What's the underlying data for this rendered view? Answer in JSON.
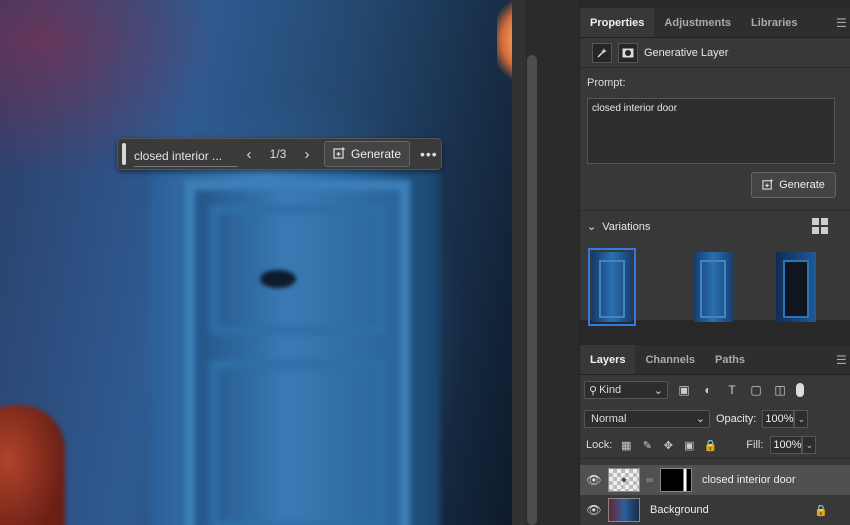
{
  "taskbar": {
    "prompt": "closed interior ...",
    "counter": "1/3",
    "generate_label": "Generate",
    "prev_icon": "chevron-left-icon",
    "next_icon": "chevron-right-icon"
  },
  "properties": {
    "tabs": [
      "Properties",
      "Adjustments",
      "Libraries"
    ],
    "active_tab": "Properties",
    "layer_type": "Generative Layer",
    "prompt_label": "Prompt:",
    "prompt_value": "closed interior door",
    "generate_label": "Generate",
    "variations_label": "Variations",
    "variations": [
      {
        "selected": true
      },
      {
        "selected": false
      },
      {
        "selected": false
      }
    ]
  },
  "layers_panel": {
    "tabs": [
      "Layers",
      "Channels",
      "Paths"
    ],
    "active_tab": "Layers",
    "kind_label": "Kind",
    "blend_mode": "Normal",
    "opacity_label": "Opacity:",
    "opacity_value": "100%",
    "lock_label": "Lock:",
    "fill_label": "Fill:",
    "fill_value": "100%",
    "layers": [
      {
        "name": "closed interior door",
        "selected": true
      },
      {
        "name": "Background",
        "selected": false
      }
    ]
  },
  "colors": {
    "accent": "#2f7ae5",
    "panel_bg": "#383838",
    "app_bg": "#282828"
  }
}
